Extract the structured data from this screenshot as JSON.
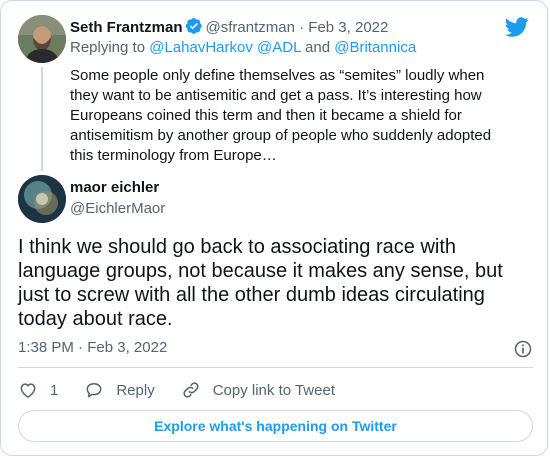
{
  "parent_tweet": {
    "author_name": "Seth Frantzman",
    "handle": "@sfrantzman",
    "separator": "·",
    "date": "Feb 3, 2022",
    "replying_prefix": "Replying to",
    "mentions": [
      "@LahavHarkov",
      "@ADL",
      "@Britannica"
    ],
    "mention_joiner_1": " ",
    "mention_joiner_2": " and ",
    "text": "Some people only define themselves as “semites” loudly when they want to be antisemitic and get a pass. It’s interesting how Europeans coined this term and then it became a shield for antisemitism by another group of people who suddenly adopted this terminology from Europe…"
  },
  "tweet": {
    "author_name": "maor eichler",
    "handle": "@EichlerMaor",
    "text": "I think we should go back to associating race with language groups, not because it makes any sense, but just to screw with all the other dumb ideas circulating today about race.",
    "time": "1:38 PM",
    "separator": "·",
    "date": "Feb 3, 2022"
  },
  "actions": {
    "like_count": "1",
    "reply_label": "Reply",
    "copy_link_label": "Copy link to Tweet"
  },
  "explore_label": "Explore what's happening on Twitter",
  "colors": {
    "accent": "#1d9bf0",
    "text": "#0f1419",
    "muted": "#536471",
    "border": "#cfd9de"
  },
  "icons": {
    "logo": "twitter-bird-icon",
    "verified": "verified-badge-icon",
    "info": "info-icon",
    "like": "heart-icon",
    "reply": "reply-bubble-icon",
    "copy": "link-icon"
  }
}
